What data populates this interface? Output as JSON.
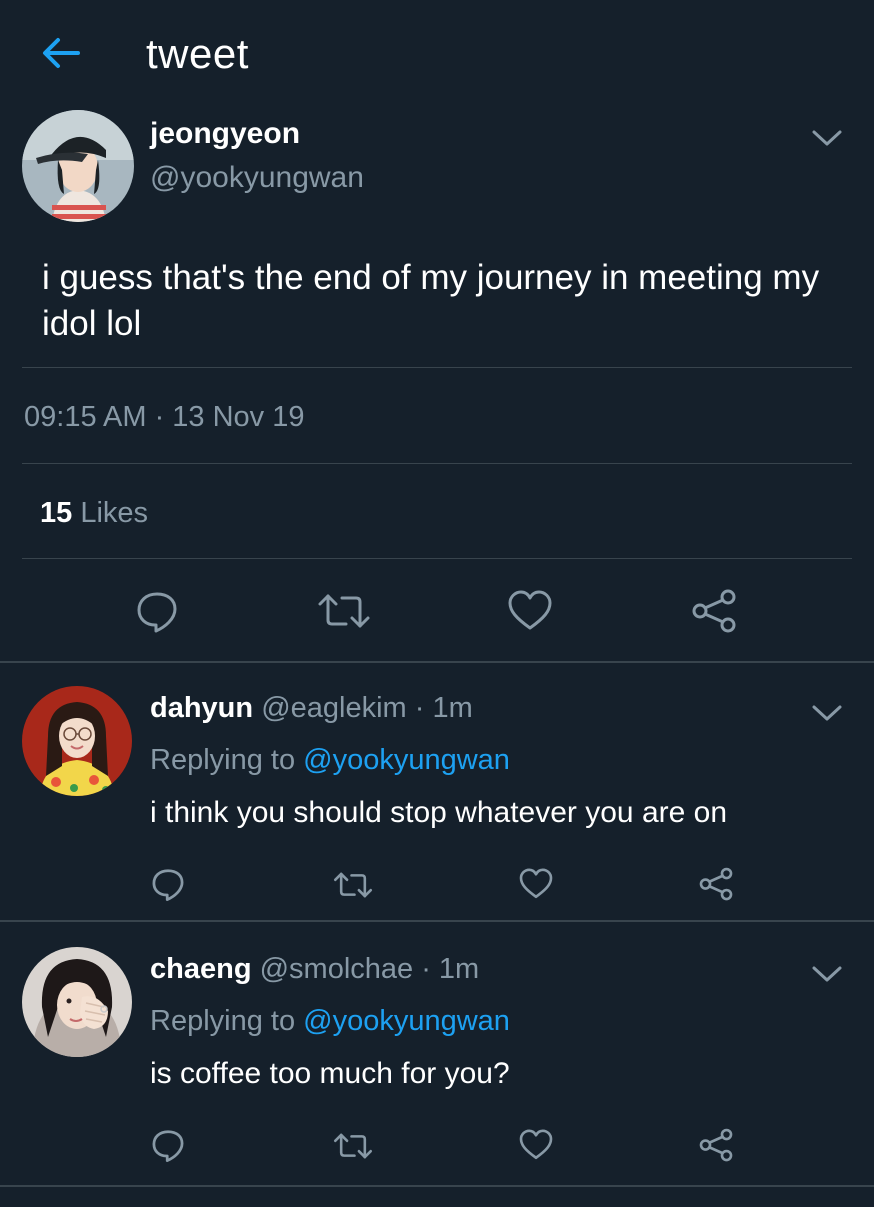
{
  "header": {
    "title": "tweet"
  },
  "main_tweet": {
    "name": "jeongyeon",
    "handle": "@yookyungwan",
    "text": "i guess that's the end of my journey in meeting my idol lol",
    "timestamp": "09:15 AM · 13 Nov 19",
    "likes_count": "15",
    "likes_label": " Likes"
  },
  "replies": [
    {
      "name": "dahyun",
      "handle": "@eaglekim",
      "time": " · 1m",
      "replying_prefix": "Replying to ",
      "replying_to": "@yookyungwan",
      "text": "i think you should stop whatever you are on"
    },
    {
      "name": "chaeng",
      "handle": "@smolchae",
      "time": " · 1m",
      "replying_prefix": "Replying to ",
      "replying_to": "@yookyungwan",
      "text": "is coffee too much for you?"
    }
  ],
  "colors": {
    "background": "#15202b",
    "accent": "#1da1f2",
    "secondary_text": "#8899a6",
    "divider": "#38444d"
  },
  "icons": [
    "back-arrow-icon",
    "chevron-down-icon",
    "reply-icon",
    "retweet-icon",
    "like-icon",
    "share-icon"
  ]
}
